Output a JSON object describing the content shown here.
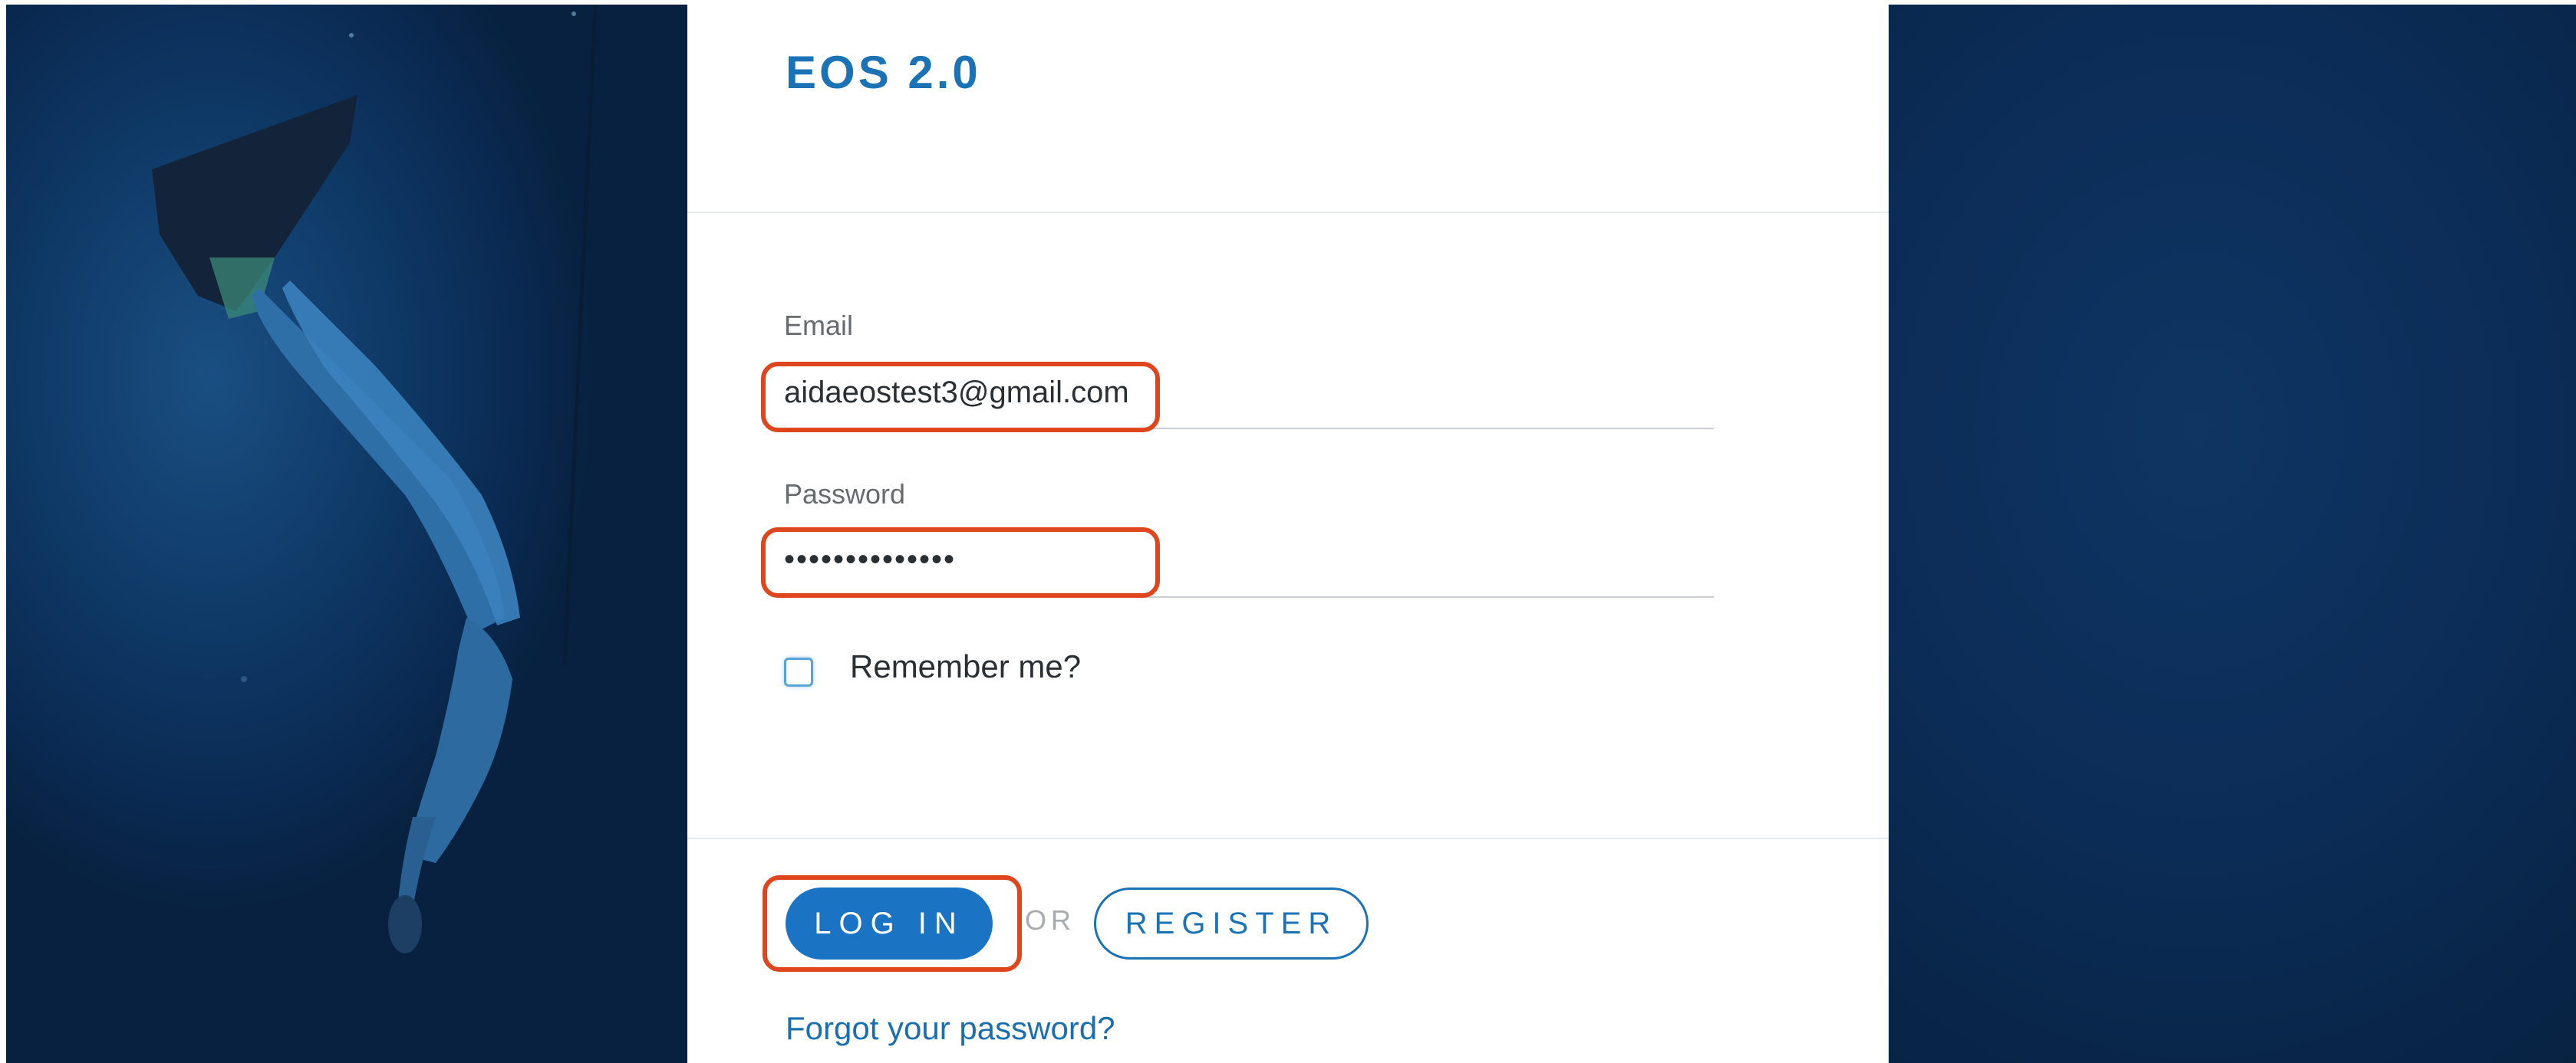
{
  "brand": {
    "title": "EOS 2.0",
    "color": "#1b73b6"
  },
  "login_form": {
    "email": {
      "label": "Email",
      "value": "aidaeostest3@gmail.com"
    },
    "password": {
      "label": "Password",
      "value": "••••••••••••••"
    },
    "remember": {
      "label": "Remember me?",
      "checked": false
    },
    "login_button": "LOG IN",
    "or_text": "OR",
    "register_button": "REGISTER",
    "forgot_link": "Forgot your password?"
  },
  "colors": {
    "accent": "#1b73c4",
    "highlight": "#e0461d",
    "background_ocean": "#0b2c56"
  },
  "background": {
    "left_image": "underwater-freediver-photo",
    "right_image": "underwater-ocean-photo"
  }
}
